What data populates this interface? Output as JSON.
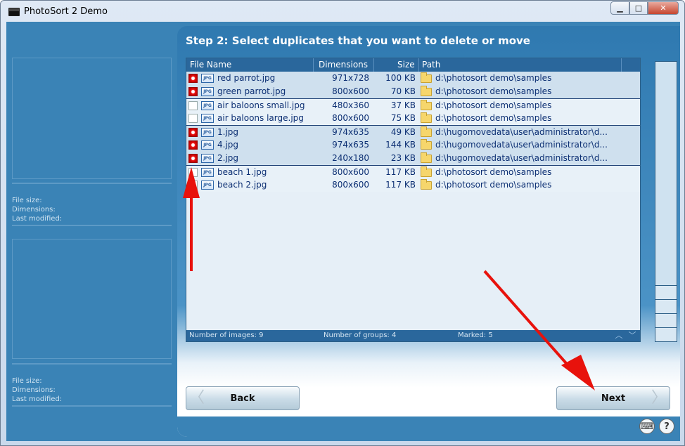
{
  "window": {
    "title": "PhotoSort 2 Demo",
    "minimize_glyph": "▁",
    "maximize_glyph": "□",
    "close_glyph": "✕"
  },
  "left_panel": {
    "top_meta": {
      "file_size": "File size:",
      "dimensions": "Dimensions:",
      "last_modified": "Last modified:"
    },
    "bottom_meta": {
      "file_size": "File size:",
      "dimensions": "Dimensions:",
      "last_modified": "Last modified:"
    }
  },
  "step_title": "Step 2:  Select duplicates that you want to delete or move",
  "table": {
    "columns": {
      "file_name": "File Name",
      "dimensions": "Dimensions",
      "size": "Size",
      "path": "Path"
    },
    "rows": [
      {
        "name": "red parrot.jpg",
        "dims": "971x728",
        "size": "100 KB",
        "path": "d:\\photosort demo\\samples",
        "marked": true,
        "group": 1
      },
      {
        "name": "green parrot.jpg",
        "dims": "800x600",
        "size": "70 KB",
        "path": "d:\\photosort demo\\samples",
        "marked": true,
        "group": 1
      },
      {
        "name": "air baloons small.jpg",
        "dims": "480x360",
        "size": "37 KB",
        "path": "d:\\photosort demo\\samples",
        "marked": false,
        "group": 2
      },
      {
        "name": "air baloons large.jpg",
        "dims": "800x600",
        "size": "75 KB",
        "path": "d:\\photosort demo\\samples",
        "marked": false,
        "group": 2
      },
      {
        "name": "1.jpg",
        "dims": "974x635",
        "size": "49 KB",
        "path": "d:\\hugomovedata\\user\\administrator\\d...",
        "marked": true,
        "group": 3
      },
      {
        "name": "4.jpg",
        "dims": "974x635",
        "size": "144 KB",
        "path": "d:\\hugomovedata\\user\\administrator\\d...",
        "marked": true,
        "group": 3
      },
      {
        "name": "2.jpg",
        "dims": "240x180",
        "size": "23 KB",
        "path": "d:\\hugomovedata\\user\\administrator\\d...",
        "marked": true,
        "group": 3
      },
      {
        "name": "beach 1.jpg",
        "dims": "800x600",
        "size": "117 KB",
        "path": "d:\\photosort demo\\samples",
        "marked": false,
        "group": 4
      },
      {
        "name": "beach 2.jpg",
        "dims": "800x600",
        "size": "117 KB",
        "path": "d:\\photosort demo\\samples",
        "marked": false,
        "group": 4
      }
    ],
    "jpg_badge": "JPG",
    "footer": {
      "images": "Number of images: 9",
      "groups": "Number of groups: 4",
      "marked": "Marked: 5",
      "up_glyph": "︿",
      "down_glyph": "﹀"
    }
  },
  "buttons": {
    "back": "Back",
    "next": "Next",
    "back_chevron": "〈",
    "next_chevron": "〉"
  },
  "corner_icons": {
    "keyboard": "⌨",
    "help": "?"
  },
  "icons": [
    "app-icon",
    "minimize-icon",
    "maximize-icon",
    "close-icon",
    "marked-checkbox-icon",
    "jpg-file-icon",
    "folder-icon",
    "scroll-up-icon",
    "scroll-down-icon",
    "back-chevron-icon",
    "next-chevron-icon",
    "keyboard-icon",
    "help-icon",
    "annotation-arrow"
  ],
  "colors": {
    "accent": "#3a83b6",
    "header": "#2a679c",
    "arrow": "#e8120c",
    "text_row": "#0c2f73"
  }
}
